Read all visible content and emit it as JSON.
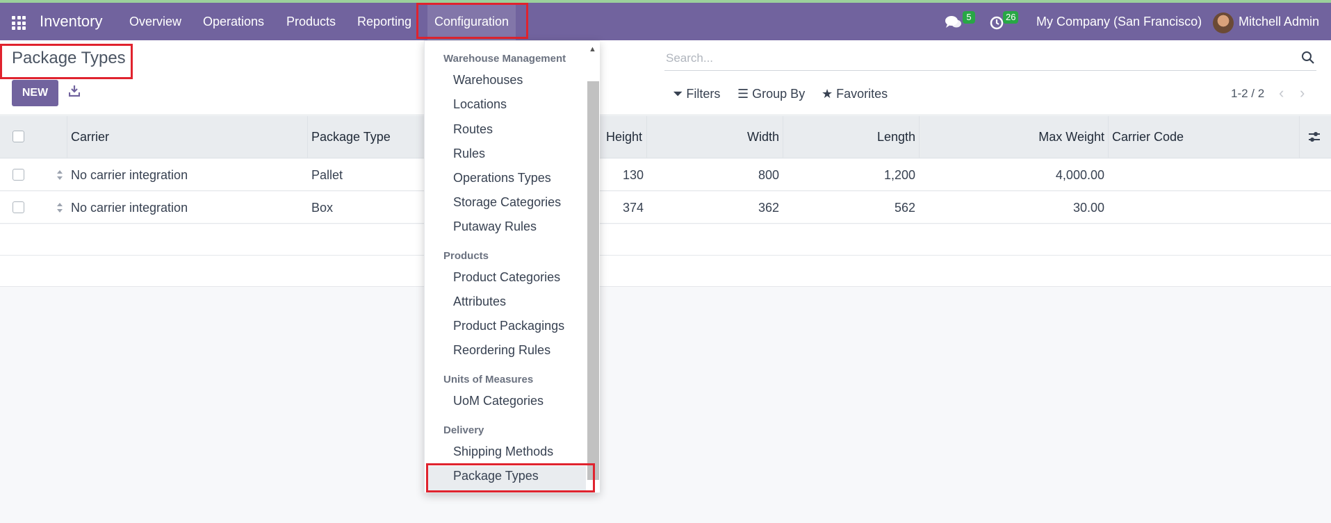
{
  "navbar": {
    "app_title": "Inventory",
    "menu": [
      "Overview",
      "Operations",
      "Products",
      "Reporting",
      "Configuration"
    ],
    "messages_count": "5",
    "activities_count": "26",
    "company": "My Company (San Francisco)",
    "user": "Mitchell Admin",
    "icons": [
      "apps-grid-icon",
      "chat-icon",
      "clock-icon"
    ]
  },
  "control_panel": {
    "title": "Package Types",
    "new_label": "NEW",
    "search_placeholder": "Search...",
    "filters_label": "Filters",
    "group_by_label": "Group By",
    "favorites_label": "Favorites",
    "pager": "1-2 / 2"
  },
  "table": {
    "headers": {
      "carrier": "Carrier",
      "package_type": "Package Type",
      "height": "Height",
      "width": "Width",
      "length": "Length",
      "max_weight": "Max Weight",
      "carrier_code": "Carrier Code"
    },
    "rows": [
      {
        "carrier": "No carrier integration",
        "package_type": "Pallet",
        "height": "130",
        "width": "800",
        "length": "1,200",
        "max_weight": "4,000.00",
        "carrier_code": ""
      },
      {
        "carrier": "No carrier integration",
        "package_type": "Box",
        "height": "374",
        "width": "362",
        "length": "562",
        "max_weight": "30.00",
        "carrier_code": ""
      }
    ]
  },
  "dropdown": {
    "sections": [
      {
        "header": "Warehouse Management",
        "items": [
          "Warehouses",
          "Locations",
          "Routes",
          "Rules",
          "Operations Types",
          "Storage Categories",
          "Putaway Rules"
        ]
      },
      {
        "header": "Products",
        "items": [
          "Product Categories",
          "Attributes",
          "Product Packagings",
          "Reordering Rules"
        ]
      },
      {
        "header": "Units of Measures",
        "items": [
          "UoM Categories"
        ]
      },
      {
        "header": "Delivery",
        "items": [
          "Shipping Methods",
          "Package Types"
        ]
      }
    ]
  },
  "colors": {
    "navbar": "#71639e",
    "highlight": "#e0232e",
    "badge": "#28a745"
  }
}
